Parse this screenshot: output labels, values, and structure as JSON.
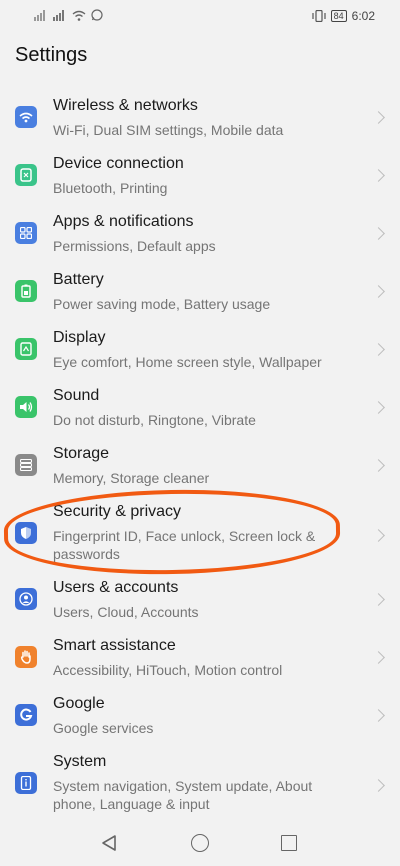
{
  "status_bar": {
    "time": "6:02",
    "battery": "84",
    "left_icons": [
      "signal-icon",
      "signal-icon",
      "wifi-icon",
      "whatsapp-icon"
    ],
    "right_icons": [
      "vibrate-icon",
      "battery-icon"
    ]
  },
  "header": {
    "title": "Settings"
  },
  "items": [
    {
      "title": "Wireless & networks",
      "subtitle": "Wi-Fi, Dual SIM settings, Mobile data",
      "icon": "wifi-icon",
      "color": "#4a7fe0"
    },
    {
      "title": "Device connection",
      "subtitle": "Bluetooth, Printing",
      "icon": "device-connection-icon",
      "color": "#3ac48a"
    },
    {
      "title": "Apps & notifications",
      "subtitle": "Permissions, Default apps",
      "icon": "apps-grid-icon",
      "color": "#4a7fe0"
    },
    {
      "title": "Battery",
      "subtitle": "Power saving mode, Battery usage",
      "icon": "battery-icon",
      "color": "#3ac46a"
    },
    {
      "title": "Display",
      "subtitle": "Eye comfort, Home screen style, Wallpaper",
      "icon": "display-icon",
      "color": "#3ac46a"
    },
    {
      "title": "Sound",
      "subtitle": "Do not disturb, Ringtone, Vibrate",
      "icon": "sound-icon",
      "color": "#3ac46a"
    },
    {
      "title": "Storage",
      "subtitle": "Memory, Storage cleaner",
      "icon": "storage-icon",
      "color": "#8a8a8a"
    },
    {
      "title": "Security & privacy",
      "subtitle": "Fingerprint ID, Face unlock, Screen lock & passwords",
      "icon": "shield-icon",
      "color": "#3d6fd8"
    },
    {
      "title": "Users & accounts",
      "subtitle": "Users, Cloud, Accounts",
      "icon": "user-icon",
      "color": "#3d6fd8"
    },
    {
      "title": "Smart assistance",
      "subtitle": "Accessibility, HiTouch, Motion control",
      "icon": "hand-icon",
      "color": "#f0822d"
    },
    {
      "title": "Google",
      "subtitle": "Google services",
      "icon": "google-icon",
      "color": "#3d6fd8"
    },
    {
      "title": "System",
      "subtitle": "System navigation, System update, About phone, Language & input",
      "icon": "phone-info-icon",
      "color": "#3d6fd8"
    }
  ],
  "highlight_color": "#f15a12",
  "navbar": {
    "icons": [
      "back-icon",
      "home-icon",
      "recents-icon"
    ]
  }
}
